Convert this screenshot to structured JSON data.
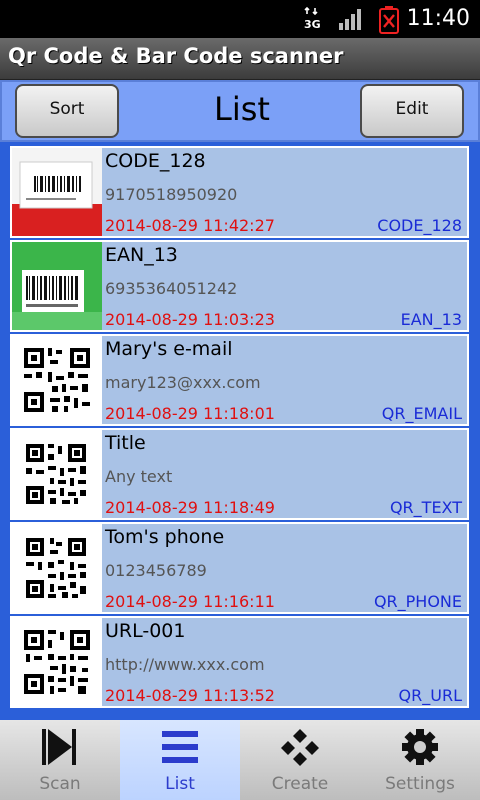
{
  "status_bar": {
    "time": "11:40",
    "network": "3G"
  },
  "app_title": "Qr Code & Bar Code scanner",
  "header": {
    "sort_label": "Sort",
    "title": "List",
    "edit_label": "Edit"
  },
  "items": [
    {
      "name": "CODE_128",
      "value": "9170518950920",
      "date": "2014-08-29 11:42:27",
      "type": "CODE_128",
      "thumb": "barcode-photo"
    },
    {
      "name": "EAN_13",
      "value": "6935364051242",
      "date": "2014-08-29 11:03:23",
      "type": "EAN_13",
      "thumb": "ean-barcode-photo"
    },
    {
      "name": "Mary's e-mail",
      "value": "mary123@xxx.com",
      "date": "2014-08-29 11:18:01",
      "type": "QR_EMAIL",
      "thumb": "qr-code"
    },
    {
      "name": "Title",
      "value": "Any text",
      "date": "2014-08-29 11:18:49",
      "type": "QR_TEXT",
      "thumb": "qr-code"
    },
    {
      "name": "Tom's phone",
      "value": "0123456789",
      "date": "2014-08-29 11:16:11",
      "type": "QR_PHONE",
      "thumb": "qr-code"
    },
    {
      "name": "URL-001",
      "value": "http://www.xxx.com",
      "date": "2014-08-29 11:13:52",
      "type": "QR_URL",
      "thumb": "qr-code"
    }
  ],
  "tabs": [
    {
      "label": "Scan",
      "icon": "play-icon",
      "active": false
    },
    {
      "label": "List",
      "icon": "list-icon",
      "active": true
    },
    {
      "label": "Create",
      "icon": "create-icon",
      "active": false
    },
    {
      "label": "Settings",
      "icon": "gear-icon",
      "active": false
    }
  ],
  "colors": {
    "header": "#7ba0f7",
    "row": "#a9c2e6",
    "date": "#e01010",
    "type": "#1a2bd6",
    "list_bg": "#2b5fd9"
  }
}
